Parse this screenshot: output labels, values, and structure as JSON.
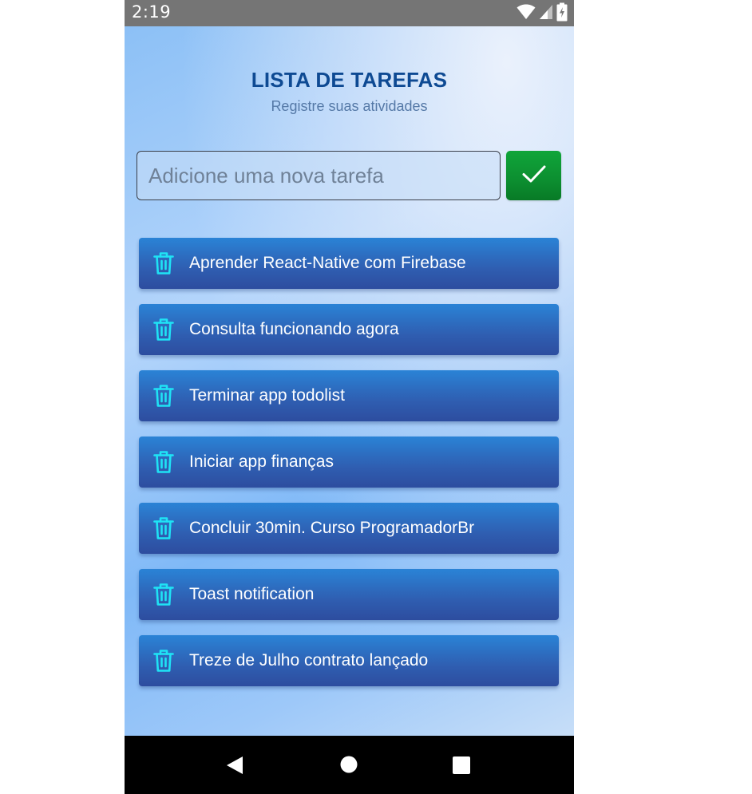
{
  "status_bar": {
    "time": "2:19",
    "icons": [
      "wifi-icon",
      "cell-signal-icon",
      "battery-charging-icon"
    ]
  },
  "header": {
    "title": "LISTA DE TAREFAS",
    "subtitle": "Registre suas atividades"
  },
  "new_task": {
    "placeholder": "Adicione uma nova tarefa",
    "value": "",
    "submit_icon": "check-icon"
  },
  "tasks": [
    {
      "label": "Aprender React-Native com Firebase",
      "icon": "trash-icon"
    },
    {
      "label": "Consulta funcionando agora",
      "icon": "trash-icon"
    },
    {
      "label": "Terminar app todolist",
      "icon": "trash-icon"
    },
    {
      "label": "Iniciar app finanças",
      "icon": "trash-icon"
    },
    {
      "label": "Concluir 30min. Curso ProgramadorBr",
      "icon": "trash-icon"
    },
    {
      "label": "Toast notification",
      "icon": "trash-icon"
    },
    {
      "label": "Treze de Julho contrato lançado",
      "icon": "trash-icon"
    }
  ],
  "nav_bar": {
    "icons": [
      "back-icon",
      "home-icon",
      "recents-icon"
    ]
  },
  "colors": {
    "title": "#0e4a93",
    "subtitle": "#5579a7",
    "task_item": "#2f5eb1",
    "trash_icon": "#1fe3f5",
    "add_button": "#0c8e30"
  }
}
